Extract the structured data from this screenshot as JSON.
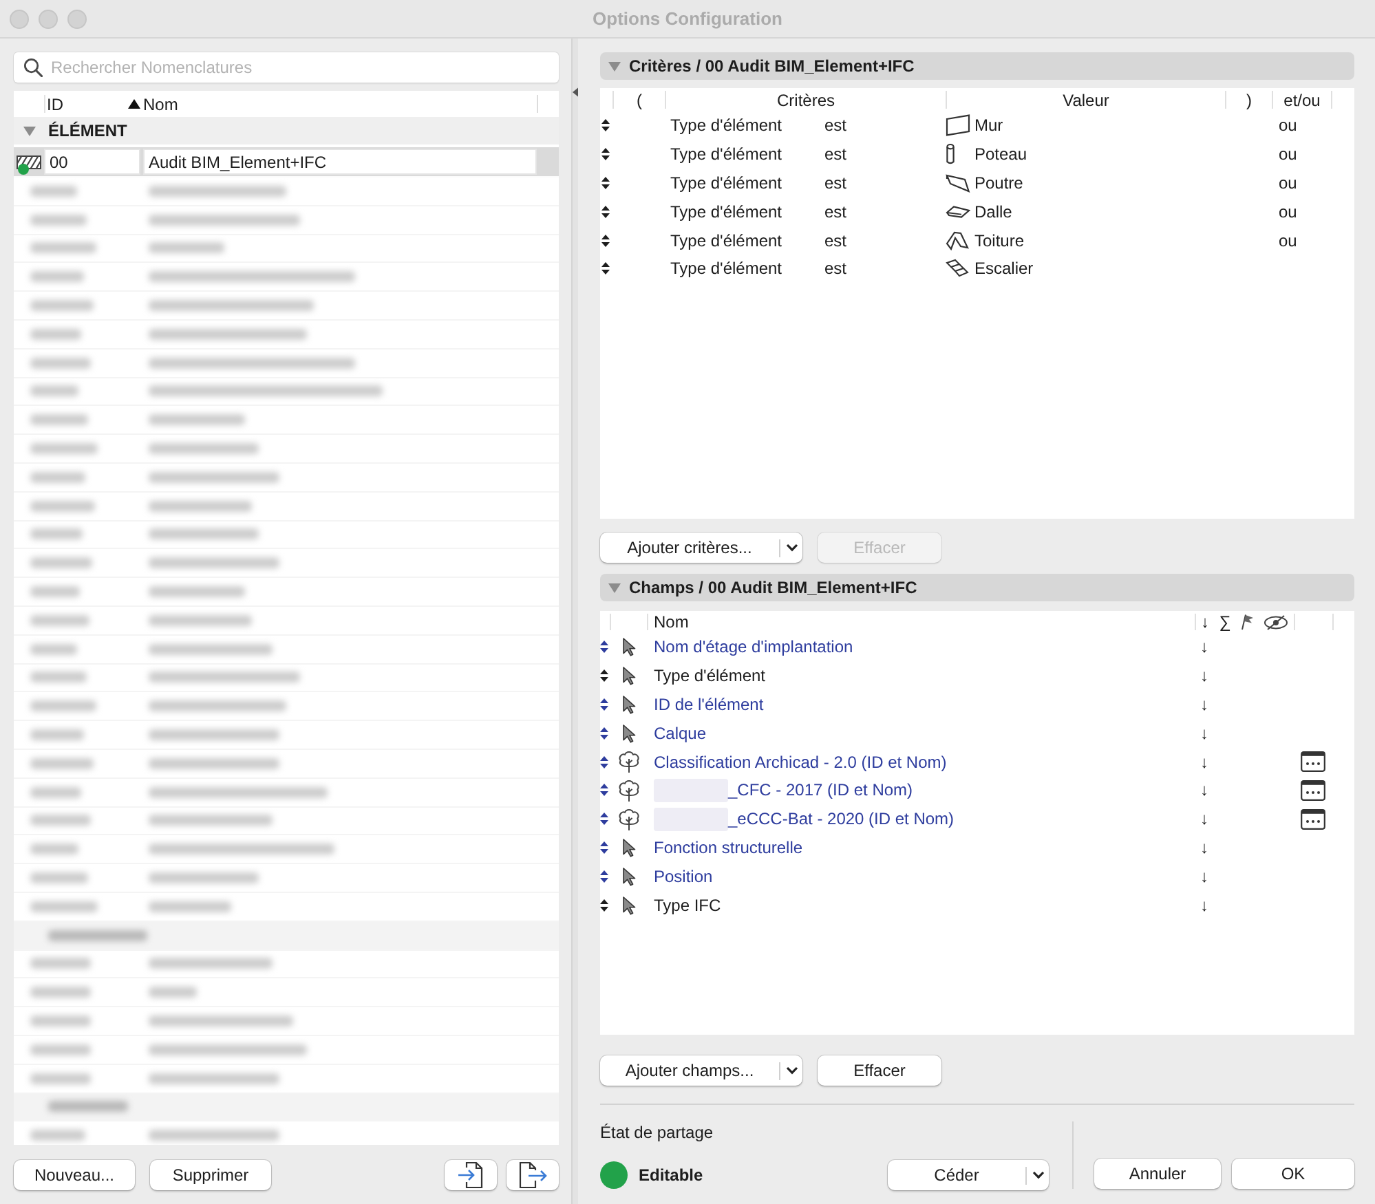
{
  "window": {
    "title": "Options Configuration"
  },
  "library": {
    "search": {
      "placeholder": "Rechercher Nomenclatures"
    },
    "columns": [
      {
        "label": "ID",
        "sorted": false
      },
      {
        "label": "Nom",
        "sorted": true
      }
    ],
    "groups": [
      {
        "label": "ÉLÉMENT",
        "expanded": true,
        "rows": [
          {
            "id": "00",
            "name": "Audit BIM_Element+IFC",
            "selected": true,
            "color": "#22a24a"
          }
        ]
      }
    ],
    "buttons": [
      {
        "label": "Nouveau..."
      },
      {
        "label": "Supprimer"
      }
    ]
  },
  "criteria": {
    "title": "Critères / 00 Audit BIM_Element+IFC",
    "expanded": true,
    "columns": [
      "(",
      "Critères",
      "Valeur",
      ")",
      "et/ou"
    ],
    "rows": [
      {
        "criterion": "Type d'élément",
        "operator": "est",
        "kind": "wall",
        "value": "Mur",
        "join": "ou"
      },
      {
        "criterion": "Type d'élément",
        "operator": "est",
        "kind": "column",
        "value": "Poteau",
        "join": "ou"
      },
      {
        "criterion": "Type d'élément",
        "operator": "est",
        "kind": "beam",
        "value": "Poutre",
        "join": "ou"
      },
      {
        "criterion": "Type d'élément",
        "operator": "est",
        "kind": "slab",
        "value": "Dalle",
        "join": "ou"
      },
      {
        "criterion": "Type d'élément",
        "operator": "est",
        "kind": "roof",
        "value": "Toiture",
        "join": "ou"
      },
      {
        "criterion": "Type d'élément",
        "operator": "est",
        "kind": "stair",
        "value": "Escalier"
      }
    ],
    "add_button": {
      "label": "Ajouter critères..."
    },
    "clear_button": {
      "label": "Effacer",
      "disabled": true
    }
  },
  "fields": {
    "title": "Champs / 00 Audit BIM_Element+IFC",
    "expanded": true,
    "header": {
      "name": "Nom",
      "sort": "↓",
      "sum": "∑"
    },
    "rows": [
      {
        "kind": "property",
        "name": "Nom d'étage d'implantation",
        "redacted": false,
        "sort": "↓",
        "color": "#2e3d9e"
      },
      {
        "kind": "property",
        "name": "Type d'élément",
        "redacted": false,
        "sort": "↓",
        "color": "#1d1d1d"
      },
      {
        "kind": "property",
        "name": "ID de l'élément",
        "redacted": false,
        "sort": "↓",
        "color": "#2e3d9e"
      },
      {
        "kind": "property",
        "name": "Calque",
        "redacted": false,
        "sort": "↓",
        "color": "#2e3d9e"
      },
      {
        "kind": "classification",
        "name": "Classification Archicad - 2.0 (ID et Nom)",
        "redacted": false,
        "sort": "↓",
        "color": "#2e3d9e"
      },
      {
        "kind": "classification",
        "name": "_CFC - 2017 (ID et Nom)",
        "redacted": true,
        "sort": "↓",
        "color": "#2e3d9e"
      },
      {
        "kind": "classification",
        "name": "_eCCC-Bat - 2020 (ID et Nom)",
        "redacted": true,
        "sort": "↓",
        "color": "#2e3d9e"
      },
      {
        "kind": "property",
        "name": "Fonction structurelle",
        "redacted": false,
        "sort": "↓",
        "color": "#2e3d9e"
      },
      {
        "kind": "property",
        "name": "Position",
        "redacted": false,
        "sort": "↓",
        "color": "#2e3d9e"
      },
      {
        "kind": "property",
        "name": "Type IFC",
        "redacted": false,
        "sort": "↓",
        "color": "#1d1d1d"
      }
    ],
    "add_button": {
      "label": "Ajouter champs..."
    },
    "clear_button": {
      "label": "Effacer",
      "disabled": false
    }
  },
  "sharing": {
    "label": "État de partage",
    "status": "Editable",
    "color": "#22a24a",
    "button": "Céder"
  },
  "buttons": [
    {
      "label": "Annuler"
    },
    {
      "label": "OK"
    }
  ]
}
